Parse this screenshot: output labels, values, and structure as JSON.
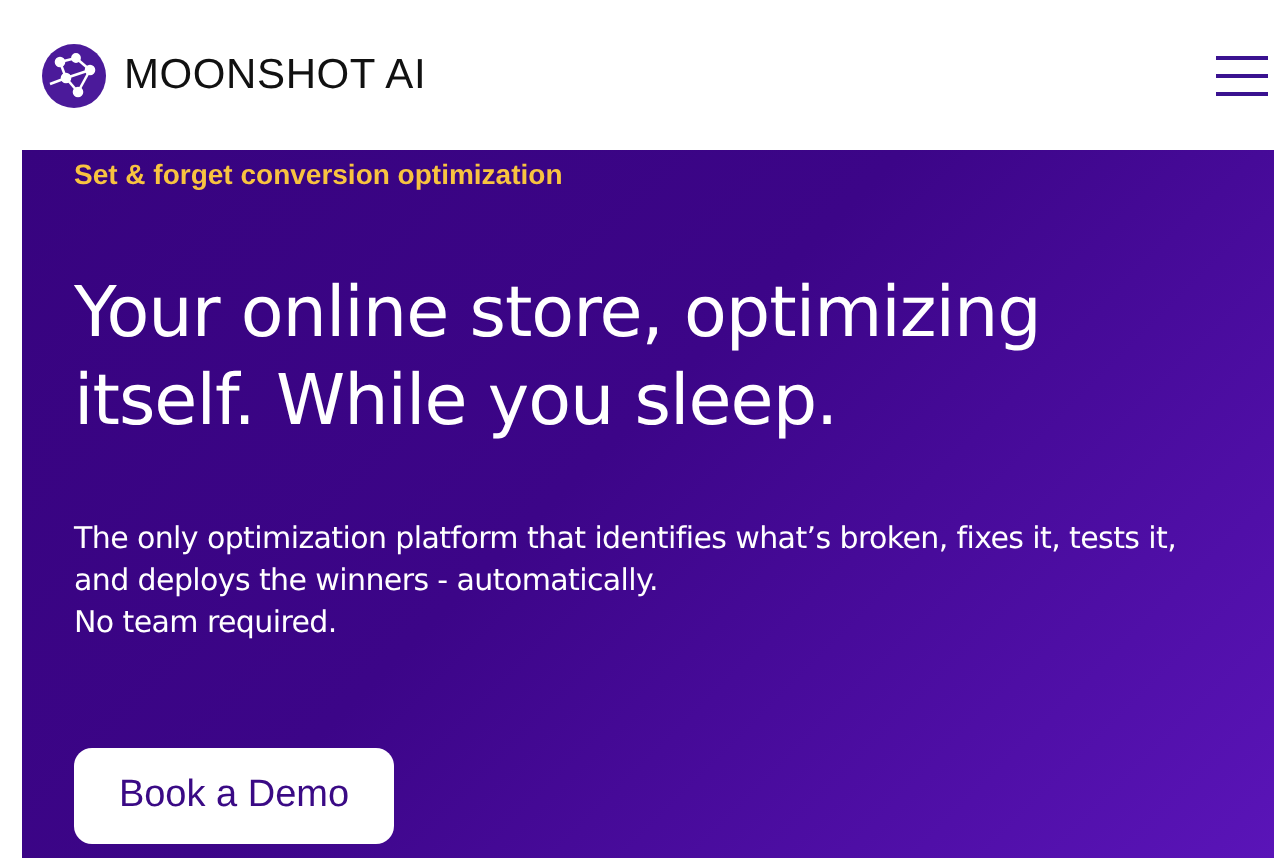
{
  "header": {
    "brand": "MOONSHOT AI"
  },
  "hero": {
    "eyebrow": "Set & forget conversion optimization",
    "headline": "Your online store, optimizing itself. While you sleep.",
    "description": "The only optimization platform that identifies what’s broken, fixes it, tests it, and deploys the winners - automatically.\nNo team required.",
    "button": "Book a Demo"
  }
}
